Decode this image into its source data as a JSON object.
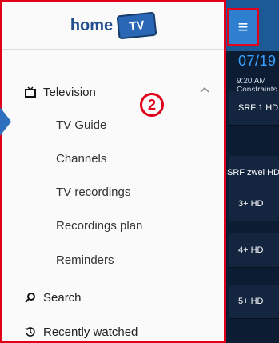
{
  "background": {
    "date": "07/19",
    "ghost_lines": [
      "9:20 AM",
      "Constraints"
    ],
    "rows": [
      {
        "label": "SRF 1 HD"
      },
      {
        "label": "SRF zwei HD"
      },
      {
        "label": "3+ HD"
      },
      {
        "label": "4+ HD"
      },
      {
        "label": "5+ HD"
      }
    ]
  },
  "header": {
    "menu_label": "≡"
  },
  "drawer": {
    "logo": {
      "text": "home",
      "badge": "TV"
    },
    "section": {
      "label": "Television",
      "expanded": true
    },
    "sub_items": [
      "TV Guide",
      "Channels",
      "TV recordings",
      "Recordings plan",
      "Reminders"
    ],
    "search_label": "Search",
    "recent_label": "Recently watched",
    "annotation": "2"
  }
}
